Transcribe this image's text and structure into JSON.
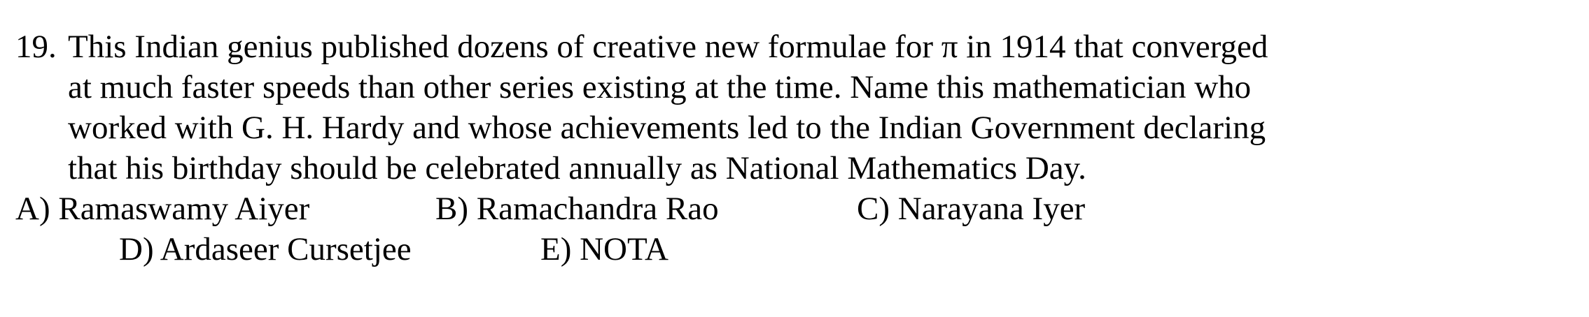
{
  "question": {
    "number": "19.",
    "lines": [
      "This Indian genius published dozens of creative new formulae for π in 1914 that converged",
      "at much faster speeds than other series existing at the time. Name this mathematician who",
      "worked with G. H. Hardy and whose achievements led to the Indian Government declaring",
      "that his birthday should be celebrated annually as National Mathematics Day."
    ]
  },
  "choices": [
    "A) Ramaswamy Aiyer",
    "B) Ramachandra Rao",
    "C) Narayana Iyer",
    "D) Ardaseer Cursetjee",
    "E) NOTA"
  ]
}
